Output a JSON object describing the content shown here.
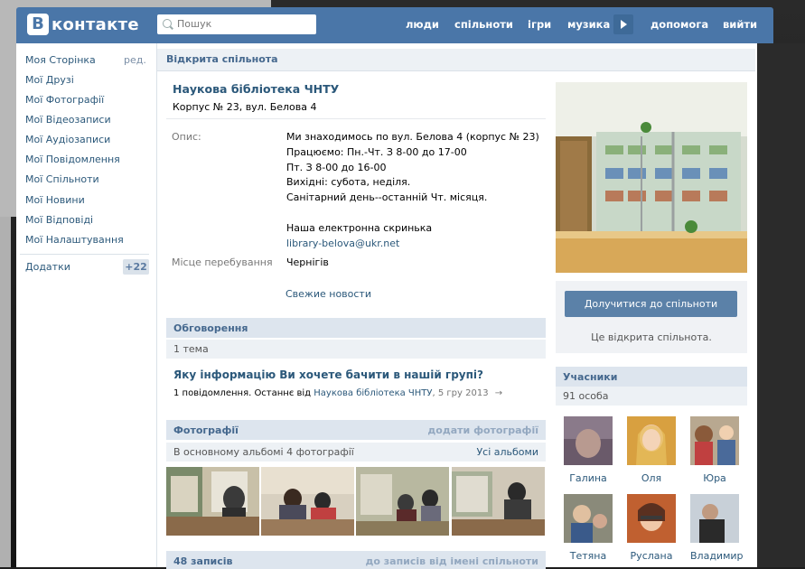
{
  "header": {
    "logo_letter": "B",
    "logo_text": "контакте",
    "search_placeholder": "Пошук",
    "nav": [
      "люди",
      "спільноти",
      "ігри",
      "музика",
      "допомога",
      "вийти"
    ]
  },
  "left_menu": {
    "items": [
      "Моя Сторінка",
      "Мої Друзі",
      "Мої Фотографії",
      "Мої Відеозаписи",
      "Мої Аудіозаписи",
      "Мої Повідомлення",
      "Мої Спільноти",
      "Мої Новини",
      "Мої Відповіді",
      "Мої Налаштування"
    ],
    "edit_label": "ред.",
    "apps_label": "Додатки",
    "apps_badge": "+22"
  },
  "top_bar": {
    "title": "Відкрита спільнота"
  },
  "group": {
    "name": "Наукова бібліотека ЧНТУ",
    "subtitle": "Корпус № 23, вул. Белова 4",
    "desc_label": "Опис:",
    "desc_lines": [
      "Ми знаходимось по вул. Белова 4 (корпус № 23)",
      "Працюємо: Пн.-Чт. З 8-00 до 17-00",
      "Пт. З 8-00 до 16-00",
      "Вихідні: субота, неділя.",
      "Санітарний день--останній Чт. місяця.",
      "Наша електронна скринька"
    ],
    "email": "library-belova@ukr.net",
    "location_label": "Місце перебування",
    "location": "Чернігів",
    "news_link": "Свежие новости"
  },
  "discussions": {
    "title": "Обговорення",
    "count": "1 тема",
    "topic_title": "Яку інформацію Ви хочете бачити в нашій групі?",
    "topic_meta_prefix": "1 повідомлення. Останнє від",
    "topic_meta_author": "Наукова бібліотека ЧНТУ",
    "topic_meta_date": ", 5 гру 2013",
    "arrow": "→"
  },
  "photos": {
    "title": "Фотографії",
    "add_link": "додати фотографії",
    "album_info": "В основному альбомі 4 фотографії",
    "all_albums": "Усі альбоми"
  },
  "wall": {
    "title": "48 записів",
    "right_link": "до записів від імені спільноти"
  },
  "right": {
    "join_button": "Долучитися до спільноти",
    "join_note": "Це відкрита спільнота.",
    "members_title": "Учасники",
    "members_count": "91 особа",
    "members": [
      "Галина",
      "Оля",
      "Юра",
      "Тетяна",
      "Руслана",
      "Владимир"
    ]
  }
}
